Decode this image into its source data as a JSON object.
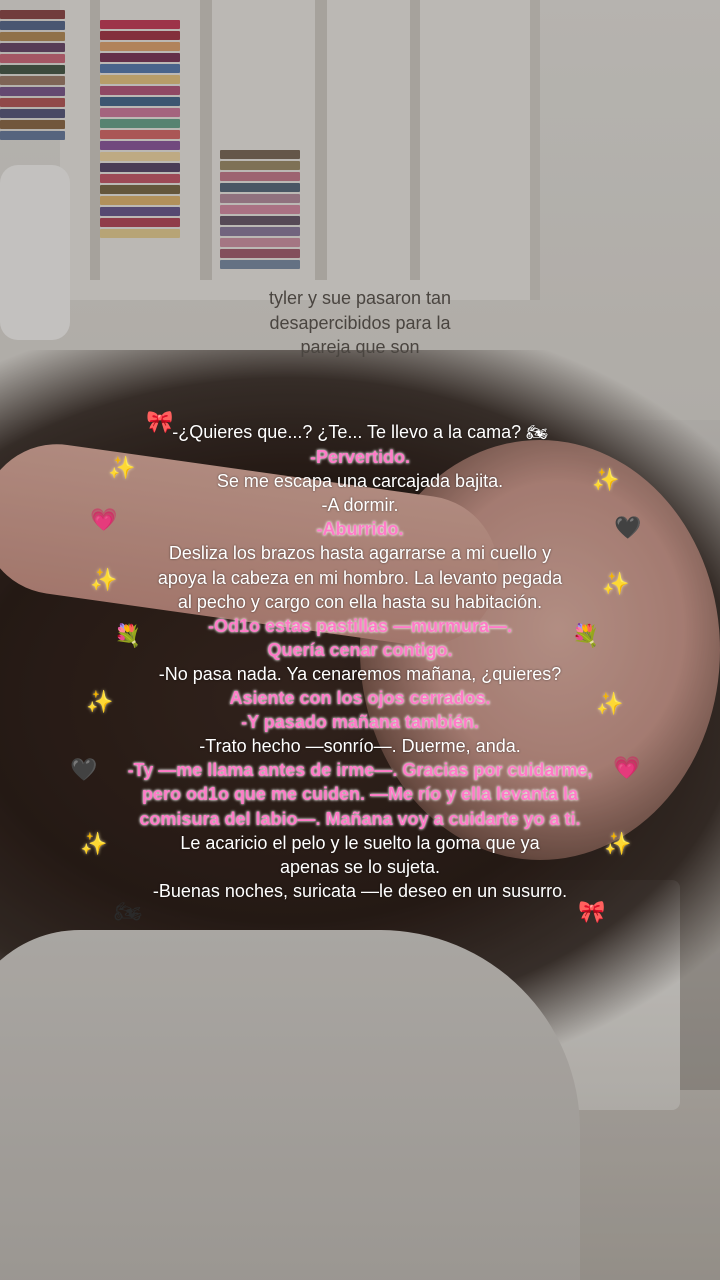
{
  "caption": "tyler y sue pasaron tan\ndesapercibidos para la\npareja que son",
  "story": [
    {
      "text": "-¿Quieres que...? ¿Te... Te llevo a la cama?",
      "style": "white"
    },
    {
      "text": "-Pervertido.",
      "style": "pink"
    },
    {
      "text": "Se me escapa una carcajada bajita.",
      "style": "white"
    },
    {
      "text": "-A dormir.",
      "style": "white"
    },
    {
      "text": "-Aburrido.",
      "style": "pink"
    },
    {
      "text": "Desliza los brazos hasta agarrarse a mi cuello y",
      "style": "white"
    },
    {
      "text": "apoya la cabeza en mi hombro. La levanto pegada",
      "style": "white"
    },
    {
      "text": "al pecho y cargo con ella hasta su habitación.",
      "style": "white"
    },
    {
      "text": "-Od1o estas pastillas —murmura—.",
      "style": "pink"
    },
    {
      "text": "Quería cenar contigo.",
      "style": "pink"
    },
    {
      "text": "-No pasa nada. Ya cenaremos mañana, ¿quieres?",
      "style": "white"
    },
    {
      "text": "Asiente con los ojos cerrados.",
      "style": "pink"
    },
    {
      "text": "-Y pasado mañana también.",
      "style": "pink"
    },
    {
      "text": "-Trato hecho —sonrío—. Duerme, anda.",
      "style": "white"
    },
    {
      "text": "-Ty —me llama antes de irme—. Gracias por cuidarme,",
      "style": "pink"
    },
    {
      "text": "pero od1o que me cuiden. —Me río y ella levanta la",
      "style": "pink"
    },
    {
      "text": "comisura del labio—. Mañana voy a cuidarte yo a ti.",
      "style": "pink"
    },
    {
      "text": "Le acaricio el pelo y le suelto la goma que ya",
      "style": "white"
    },
    {
      "text": "apenas se lo sujeta.",
      "style": "white"
    },
    {
      "text": "-Buenas noches, suricata —le deseo en un susurro.",
      "style": "white"
    }
  ],
  "icons": {
    "bow": "🎀",
    "motorcycle": "🏍",
    "sparkles": "✨",
    "pink_heart": "💗",
    "black_heart": "🖤",
    "bouquet": "💐"
  },
  "colors": {
    "pink_text": "#ff7bc8",
    "white_text": "#ffffff",
    "caption_text": "#4a4540"
  }
}
